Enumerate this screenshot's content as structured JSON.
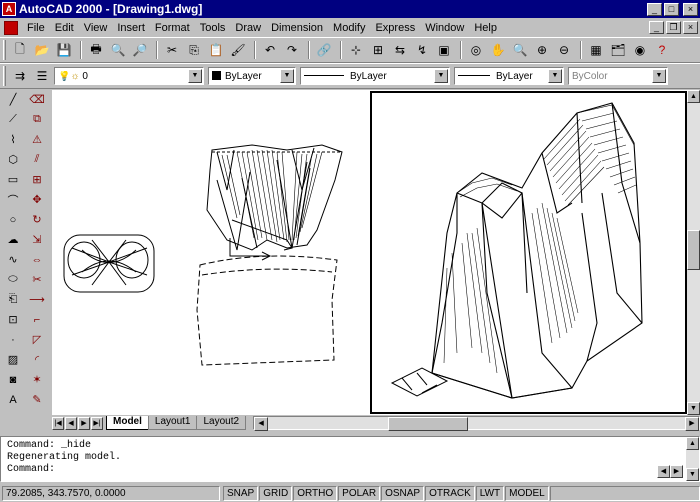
{
  "window": {
    "title": "AutoCAD 2000 - [Drawing1.dwg]",
    "app_icon": "A",
    "controls": {
      "minimize": "_",
      "maximize": "□",
      "close": "×"
    }
  },
  "menubar": {
    "items": [
      "File",
      "Edit",
      "View",
      "Insert",
      "Format",
      "Tools",
      "Draw",
      "Dimension",
      "Modify",
      "Express",
      "Window",
      "Help"
    ],
    "doc_controls": {
      "minimize": "_",
      "restore": "❐",
      "close": "×"
    }
  },
  "toolbar_standard": {
    "icons": [
      "new-icon",
      "open-icon",
      "save-icon",
      "print-icon",
      "print-preview-icon",
      "find-icon",
      "cut-icon",
      "copy-icon",
      "paste-icon",
      "match-properties-icon",
      "undo-icon",
      "redo-icon",
      "hyperlink-icon",
      "osnap-icon",
      "ucs-icon",
      "tracking-icon",
      "redraw-icon",
      "named-views-icon",
      "3d-orbit-icon",
      "pan-icon",
      "zoom-realtime-icon",
      "zoom-window-icon",
      "zoom-previous-icon",
      "properties-icon",
      "design-center-icon",
      "today-icon",
      "help-icon"
    ],
    "glyphs": [
      "🗋",
      "📂",
      "💾",
      "🖶",
      "🔍",
      "🔎",
      "✂",
      "⎘",
      "📋",
      "🖌",
      "↶",
      "↷",
      "🔗",
      "⊹",
      "⊞",
      "⇆",
      "↯",
      "▣",
      "◎",
      "✋",
      "🔍",
      "⊕",
      "⊖",
      "▦",
      "🗂",
      "◉",
      "?"
    ]
  },
  "toolbar_props": {
    "layer_value": "0",
    "color_value": "ByLayer",
    "linetype_value": "ByLayer",
    "lineweight_value": "ByLayer",
    "plotstyle_value": "ByColor"
  },
  "draw_toolbar": {
    "icons": [
      "line-icon",
      "erase-icon",
      "construction-line-icon",
      "copy-object-icon",
      "polyline-icon",
      "mirror-icon",
      "polygon-icon",
      "offset-icon",
      "rectangle-icon",
      "array-icon",
      "arc-icon",
      "move-icon",
      "circle-icon",
      "rotate-icon",
      "revcloud-icon",
      "scale-icon",
      "spline-icon",
      "stretch-icon",
      "ellipse-icon",
      "trim-icon",
      "insert-block-icon",
      "extend-icon",
      "make-block-icon",
      "break-icon",
      "point-icon",
      "chamfer-icon",
      "hatch-icon",
      "fillet-icon",
      "region-icon",
      "explode-icon",
      "multiline-text-icon",
      "explode-icon-2"
    ],
    "glyphs": [
      "╱",
      "⌫",
      "⟋",
      "⧉",
      "⌇",
      "⚠",
      "⬡",
      "⫽",
      "▭",
      "⊞",
      "⌒",
      "✥",
      "○",
      "↻",
      "☁",
      "⇲",
      "∿",
      "⇔",
      "⬭",
      "✂",
      "⎗",
      "⟶",
      "⊡",
      "⌐",
      "·",
      "◸",
      "▨",
      "◜",
      "◙",
      "✶",
      "A",
      "✎"
    ]
  },
  "tabs": [
    "Model",
    "Layout1",
    "Layout2"
  ],
  "active_tab": "Model",
  "command_window": {
    "lines": [
      "Command: _hide",
      "Regenerating model.",
      "Command:"
    ]
  },
  "statusbar": {
    "coordinates": "79.2085, 343.7570, 0.0000",
    "toggles": [
      "SNAP",
      "GRID",
      "ORTHO",
      "POLAR",
      "OSNAP",
      "OTRACK",
      "LWT",
      "MODEL"
    ]
  }
}
